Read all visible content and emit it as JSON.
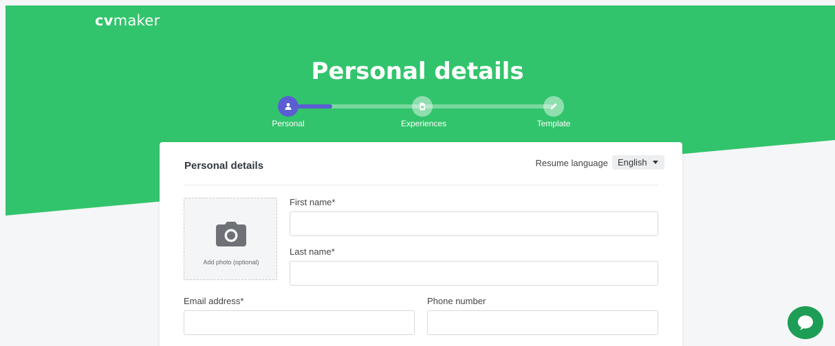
{
  "brand": {
    "bold": "cv",
    "rest": "maker"
  },
  "page_title": "Personal details",
  "steps": [
    {
      "label": "Personal",
      "icon": "person-icon",
      "active": true
    },
    {
      "label": "Experiences",
      "icon": "document-icon",
      "active": false
    },
    {
      "label": "Template",
      "icon": "pencil-icon",
      "active": false
    }
  ],
  "progress_fraction": 0.17,
  "card": {
    "title": "Personal details",
    "resume_language_label": "Resume language",
    "resume_language_value": "English",
    "photo": {
      "label": "Add photo (optional)",
      "icon": "camera-icon"
    },
    "fields": {
      "first_name": {
        "label": "First name*",
        "value": ""
      },
      "last_name": {
        "label": "Last name*",
        "value": ""
      },
      "email": {
        "label": "Email address*",
        "value": ""
      },
      "phone": {
        "label": "Phone number",
        "value": ""
      }
    }
  },
  "chat": {
    "icon": "chat-bubble-icon"
  },
  "colors": {
    "brand_green": "#32c46c",
    "step_active": "#5a5ed2",
    "chat_green": "#1d9d55",
    "page_bg": "#f5f6f7"
  }
}
